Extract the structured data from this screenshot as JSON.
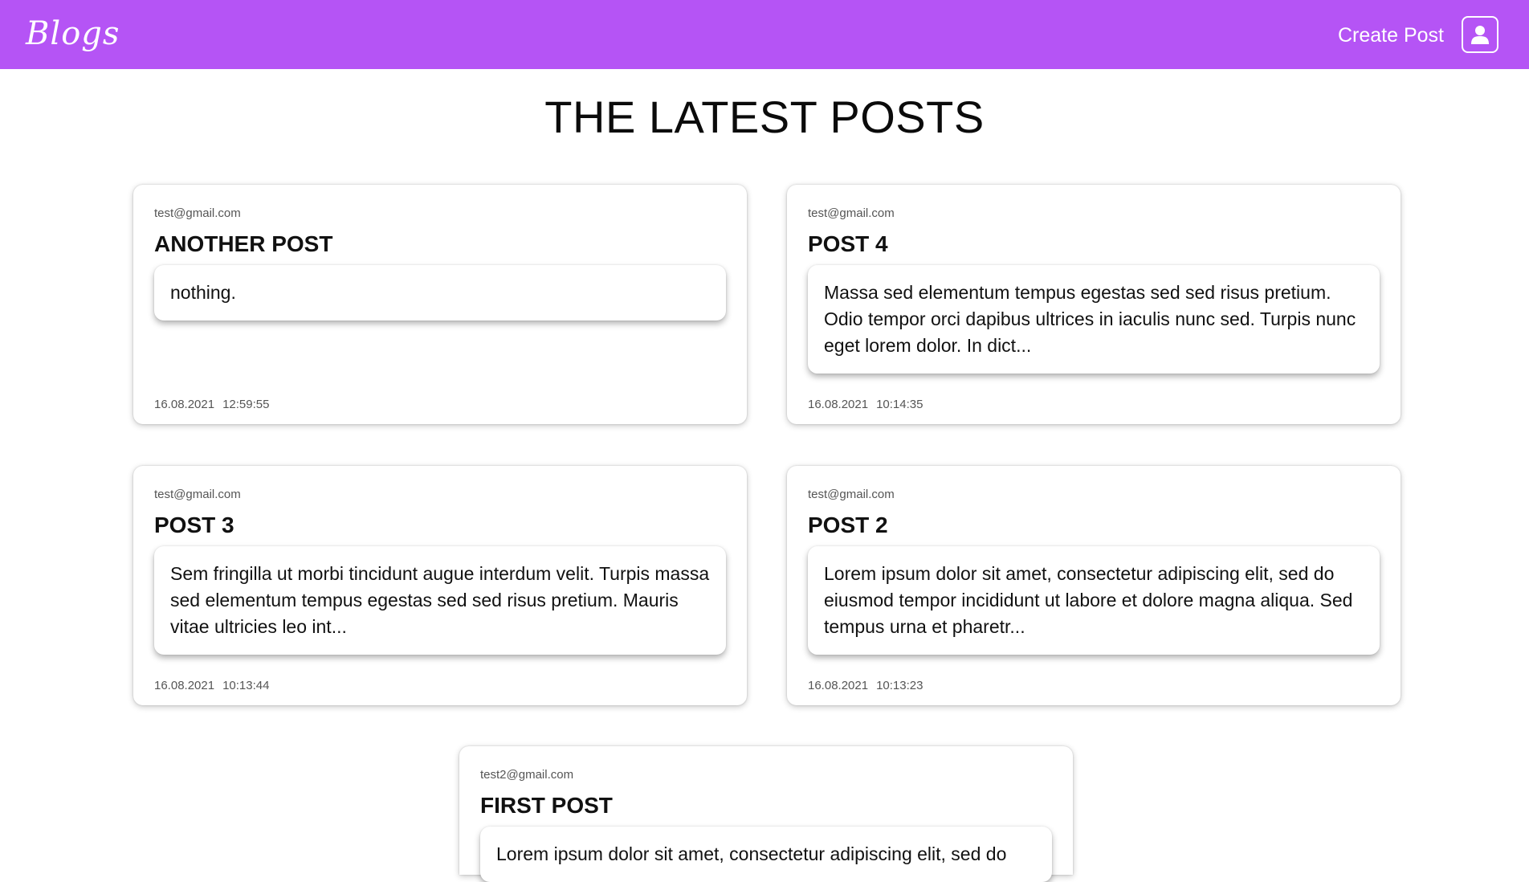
{
  "navbar": {
    "logo_text": "Blogs",
    "create_post_label": "Create Post",
    "profile_icon": "user-icon",
    "background_color": "#b554f5"
  },
  "page": {
    "title": "THE LATEST POSTS"
  },
  "posts": [
    {
      "author": "test@gmail.com",
      "title": "ANOTHER POST",
      "body": "nothing.",
      "date": "16.08.2021",
      "time": "12:59:55"
    },
    {
      "author": "test@gmail.com",
      "title": "POST 4",
      "body": "Massa sed elementum tempus egestas sed sed risus pretium. Odio tempor orci dapibus ultrices in iaculis nunc sed. Turpis nunc eget lorem dolor. In dict...",
      "date": "16.08.2021",
      "time": "10:14:35"
    },
    {
      "author": "test@gmail.com",
      "title": "POST 3",
      "body": "Sem fringilla ut morbi tincidunt augue interdum velit. Turpis massa sed elementum tempus egestas sed sed risus pretium. Mauris vitae ultricies leo int...",
      "date": "16.08.2021",
      "time": "10:13:44"
    },
    {
      "author": "test@gmail.com",
      "title": "POST 2",
      "body": "Lorem ipsum dolor sit amet, consectetur adipiscing elit, sed do eiusmod tempor incididunt ut labore et dolore magna aliqua. Sed tempus urna et pharetr...",
      "date": "16.08.2021",
      "time": "10:13:23"
    },
    {
      "author": "test2@gmail.com",
      "title": "FIRST POST",
      "body": "Lorem ipsum dolor sit amet, consectetur adipiscing elit, sed do"
    }
  ]
}
